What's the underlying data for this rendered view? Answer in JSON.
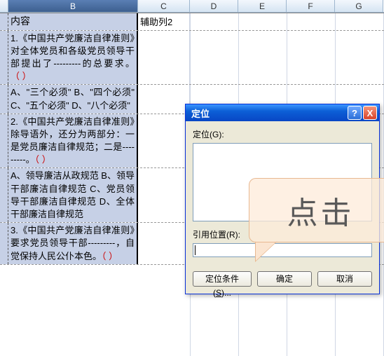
{
  "columns": {
    "B": "B",
    "C": "C",
    "D": "D",
    "E": "E",
    "F": "F",
    "G": "G"
  },
  "header_row": {
    "b": "内容",
    "c": "辅助列2"
  },
  "rows": [
    {
      "b_pre": "1.《中国共产党廉洁自律准则》对全体党员和各级党员领导干部提出了---------的总要求。",
      "paren": "（    ）"
    },
    {
      "b_pre": "A、\"三个必须\" B、\"四个必须\" C、\"五个必须\" D、\"八个必须\"",
      "paren": ""
    },
    {
      "b_pre": "2.《中国共产党廉洁自律准则》除导语外，还分为两部分：一是党员廉洁自律规范；二是---------。",
      "paren": "（    ）"
    },
    {
      "b_pre": "A、领导廉洁从政规范  B、领导干部廉洁自律规范  C、党员领导干部廉洁自律规范  D、全体干部廉洁自律规范",
      "paren": ""
    },
    {
      "b_pre": "3.《中国共产党廉洁自律准则》要求党员领导干部---------，自觉保持人民公仆本色。",
      "paren": "（    ）"
    }
  ],
  "dialog": {
    "title": "定位",
    "label_goto": "定位(G):",
    "label_ref": "引用位置(R):",
    "btn_cond_pre": "定位条件(",
    "btn_cond_key": "S",
    "btn_cond_post": ")...",
    "btn_ok": "确定",
    "btn_cancel": "取消",
    "help": "?",
    "close": "X"
  },
  "callout": {
    "text": "点击"
  }
}
